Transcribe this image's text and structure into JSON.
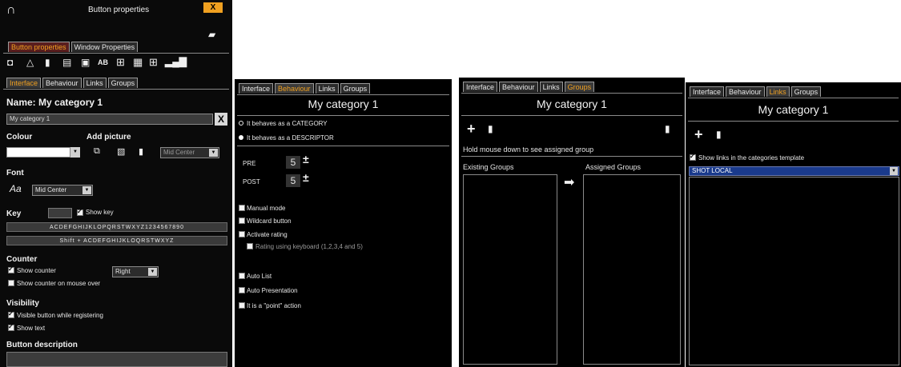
{
  "panel1": {
    "window_title": "Button properties",
    "tabs_top": [
      "Button properties",
      "Window Properties"
    ],
    "tabs": [
      "Interface",
      "Behaviour",
      "Links",
      "Groups"
    ],
    "name_heading": "Name: My category 1",
    "name_value": "My category 1",
    "clear_label": "X",
    "colour_label": "Colour",
    "add_picture_label": "Add picture",
    "picture_position": "Mid Center",
    "font_label": "Font",
    "font_position": "Mid Center",
    "key_label": "Key",
    "show_key_label": "Show key",
    "key_row1": "ACDEFGHIJKLOPQRSTWXYZ1234567890",
    "key_row2": "Shift + ACDEFGHIJKLOQRSTWXYZ",
    "counter_label": "Counter",
    "show_counter_label": "Show counter",
    "counter_position": "Right",
    "show_counter_mouse_label": "Show counter on mouse over",
    "visibility_label": "Visibility",
    "visible_while_registering_label": "Visible button while registering",
    "show_text_label": "Show text",
    "button_description_label": "Button description",
    "close_label": "X"
  },
  "panel2": {
    "tabs": [
      "Interface",
      "Behaviour",
      "Links",
      "Groups"
    ],
    "title": "My category 1",
    "radio_category": "It behaves as a CATEGORY",
    "radio_descriptor": "It behaves as a DESCRIPTOR",
    "pre_label": "PRE",
    "pre_value": "5",
    "post_label": "POST",
    "post_value": "5",
    "manual_mode": "Manual mode",
    "wildcard_button": "Wildcard button",
    "activate_rating": "Activate rating",
    "rating_keyboard": "Rating using keyboard (1,2,3,4 and 5)",
    "auto_list": "Auto List",
    "auto_presentation": "Auto Presentation",
    "point_action": "It is a \"point\" action"
  },
  "panel3": {
    "tabs": [
      "Interface",
      "Behaviour",
      "Links",
      "Groups"
    ],
    "title": "My category 1",
    "hint": "Hold mouse down to see assigned group",
    "existing_groups": "Existing Groups",
    "assigned_groups": "Assigned Groups"
  },
  "panel4": {
    "tabs": [
      "Interface",
      "Behaviour",
      "Links",
      "Groups"
    ],
    "title": "My category 1",
    "show_links_label": "Show links in the categories template",
    "selected_link": "SHOT LOCAL"
  },
  "colors": {
    "accent": "#f0a020",
    "background": "#000000",
    "selected_blue": "#1a3a8c"
  }
}
